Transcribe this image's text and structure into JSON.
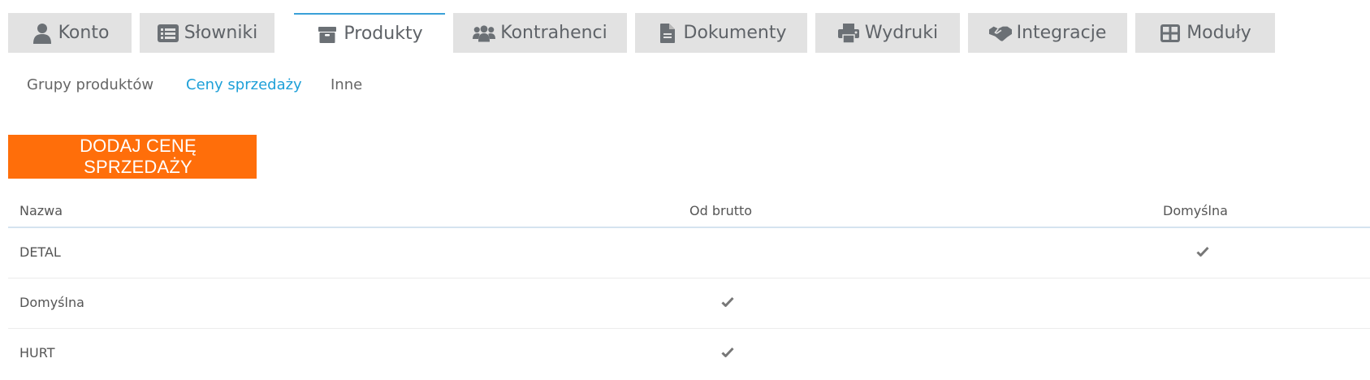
{
  "tabs": [
    {
      "label": "Konto",
      "icon": "user-icon",
      "active": false
    },
    {
      "label": "Słowniki",
      "icon": "list-icon",
      "active": false
    },
    {
      "label": "Produkty",
      "icon": "box-icon",
      "active": true
    },
    {
      "label": "Kontrahenci",
      "icon": "users-icon",
      "active": false
    },
    {
      "label": "Dokumenty",
      "icon": "document-icon",
      "active": false
    },
    {
      "label": "Wydruki",
      "icon": "printer-icon",
      "active": false
    },
    {
      "label": "Integracje",
      "icon": "handshake-icon",
      "active": false
    },
    {
      "label": "Moduły",
      "icon": "grid-icon",
      "active": false
    }
  ],
  "subnav": [
    {
      "label": "Grupy produktów",
      "active": false
    },
    {
      "label": "Ceny sprzedaży",
      "active": true
    },
    {
      "label": "Inne",
      "active": false
    }
  ],
  "add_button": {
    "label": "DODAJ CENĘ SPRZEDAŻY"
  },
  "table": {
    "headers": {
      "name": "Nazwa",
      "gross": "Od brutto",
      "default": "Domyślna"
    },
    "rows": [
      {
        "name": "DETAL",
        "gross": false,
        "default": true
      },
      {
        "name": "Domyślna",
        "gross": true,
        "default": false
      },
      {
        "name": "HURT",
        "gross": true,
        "default": false
      }
    ]
  },
  "colors": {
    "accent_orange": "#ff6e0a",
    "active_link_blue": "#1ea0d8",
    "tab_bg": "#e2e2e2",
    "icon_grey": "#6b7075"
  }
}
